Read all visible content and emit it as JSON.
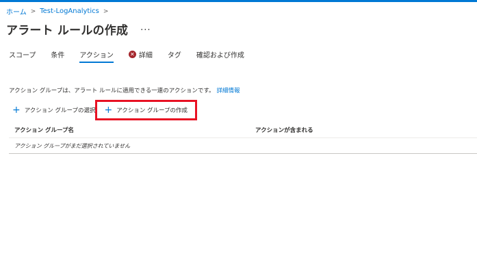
{
  "breadcrumb": {
    "items": [
      "ホーム",
      "Test-LogAnalytics"
    ],
    "separator": ">"
  },
  "page": {
    "title": "アラート ルールの作成",
    "more": "..."
  },
  "tabs": [
    {
      "label": "スコープ",
      "active": false
    },
    {
      "label": "条件",
      "active": false
    },
    {
      "label": "アクション",
      "active": true
    },
    {
      "label": "詳細",
      "active": false,
      "status": "error"
    },
    {
      "label": "タグ",
      "active": false
    },
    {
      "label": "確認および作成",
      "active": false
    }
  ],
  "description": {
    "text": "アクション グループは、アラート ルールに適用できる一連のアクションです。",
    "link": "詳細情報"
  },
  "commands": {
    "select_label": "アクション グループの選択",
    "create_label": "アクション グループの作成",
    "icon": "plus-icon"
  },
  "table": {
    "columns": [
      "アクション グループ名",
      "アクションが含まれる"
    ],
    "empty_message": "アクション グループがまだ選択されていません"
  },
  "colors": {
    "accent": "#0078d4",
    "highlight": "#e81123",
    "error": "#a4262c"
  }
}
